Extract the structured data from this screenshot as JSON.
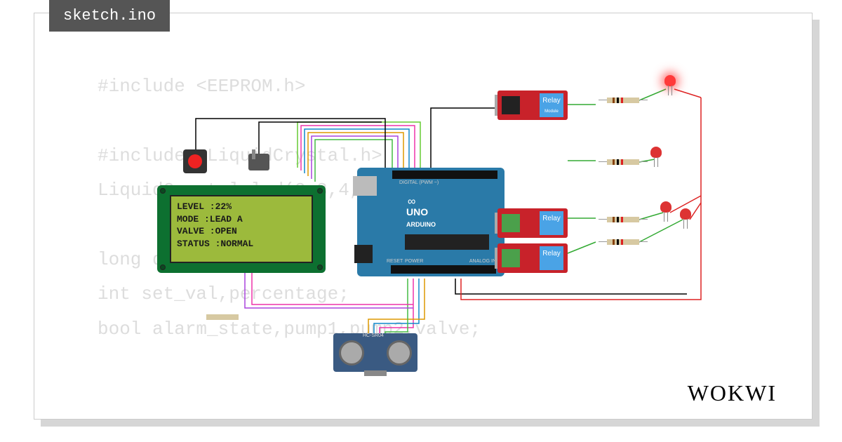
{
  "tab": {
    "filename": "sketch.ino"
  },
  "code_preview": "#include <EEPROM.h>\n\n#include <LiquidCrystal.h>\nLiquidCrystal lcd(2,3,4,5,6,7);\n\nlong duration;\nint set_val,percentage;\nbool alarm_state,pump1,pump2,valve;",
  "lcd": {
    "line1": "LEVEL  :22%",
    "line2": "MODE   :LEAD A",
    "line3": "VALVE  :OPEN",
    "line4": "STATUS :NORMAL"
  },
  "arduino": {
    "board_name": "UNO",
    "brand": "ARDUINO",
    "infinity": "∞",
    "digital_label": "DIGITAL (PWM ~)",
    "analog_label": "ANALOG IN",
    "power_label": "POWER",
    "reset_label": "RESET"
  },
  "relay": {
    "label": "Relay",
    "sublabel": "Module"
  },
  "ultrasonic": {
    "label": "HC-SR04"
  },
  "components": {
    "pushbutton_name": "pushbutton",
    "switch_name": "slide-switch",
    "led_count": 4,
    "resistor_count": 5,
    "relay_count": 3
  },
  "branding": {
    "logo": "WOKWI"
  }
}
